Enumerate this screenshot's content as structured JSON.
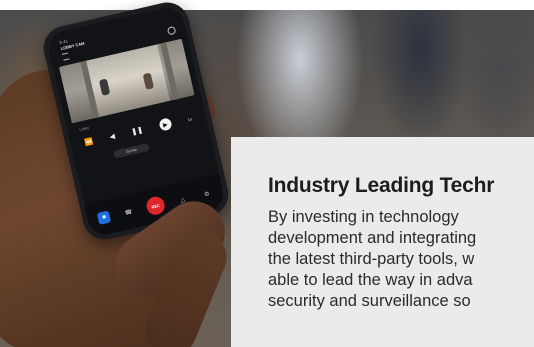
{
  "hero": {
    "image_alt_subject": "hand holding smartphone showing security camera app",
    "phone_screen": {
      "status_text": "9:41",
      "app_title": "LOBBY CAM",
      "controls_label": "Lobby",
      "rewind_icon": "rewind-icon",
      "back_icon": "step-back-icon",
      "pause_icon": "pause-icon",
      "play_icon": "play-icon",
      "speed_label": "1x",
      "live_pill": "Go live",
      "nav_icons": [
        "camera-icon",
        "phone-icon",
        "record-icon",
        "alert-icon",
        "settings-icon"
      ],
      "record_label": "REC"
    }
  },
  "card": {
    "title": "Industry Leading Techr",
    "body_lines": [
      "By investing in technology",
      "development and integrating",
      "the latest third-party tools, w",
      "able to lead the way in adva",
      "security and surveillance so"
    ]
  },
  "colors": {
    "card_background": "#ebebeb",
    "title_text": "#1c1c1c",
    "body_text": "#2a2a2a",
    "record_button": "#e0262c",
    "nav_accent": "#1f6fe0"
  }
}
